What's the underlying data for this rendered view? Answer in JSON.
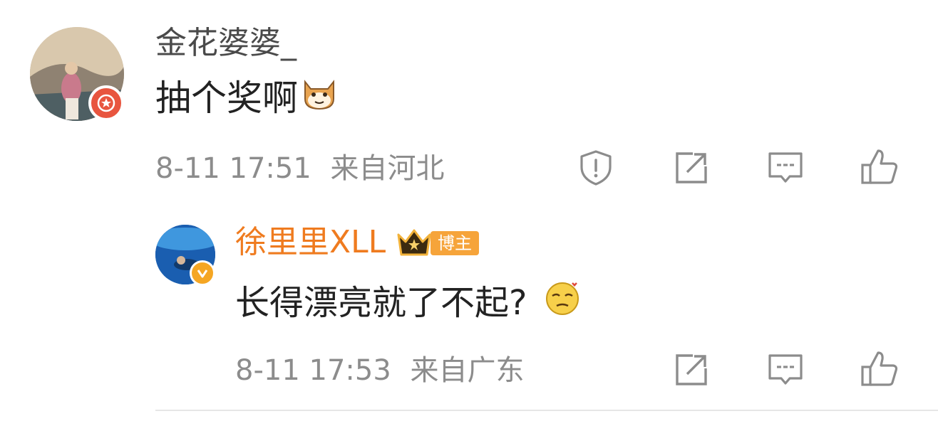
{
  "comment": {
    "username": "金花婆婆_",
    "text": "抽个奖啊",
    "emoji": "cat-emoji",
    "time": "8-11 17:51",
    "location": "来自河北",
    "badge_color": "#e8553f"
  },
  "reply": {
    "username": "徐里里XLL",
    "role_badge": "博主",
    "text": "长得漂亮就了不起?",
    "emoji": "smug-face-emoji",
    "time": "8-11 17:53",
    "location": "来自广东",
    "name_color": "#ef7b1f",
    "badge_color": "#f5a623"
  },
  "icons": {
    "report": "shield-exclamation-icon",
    "share": "share-icon",
    "comment": "comment-icon",
    "like": "thumbs-up-icon"
  }
}
